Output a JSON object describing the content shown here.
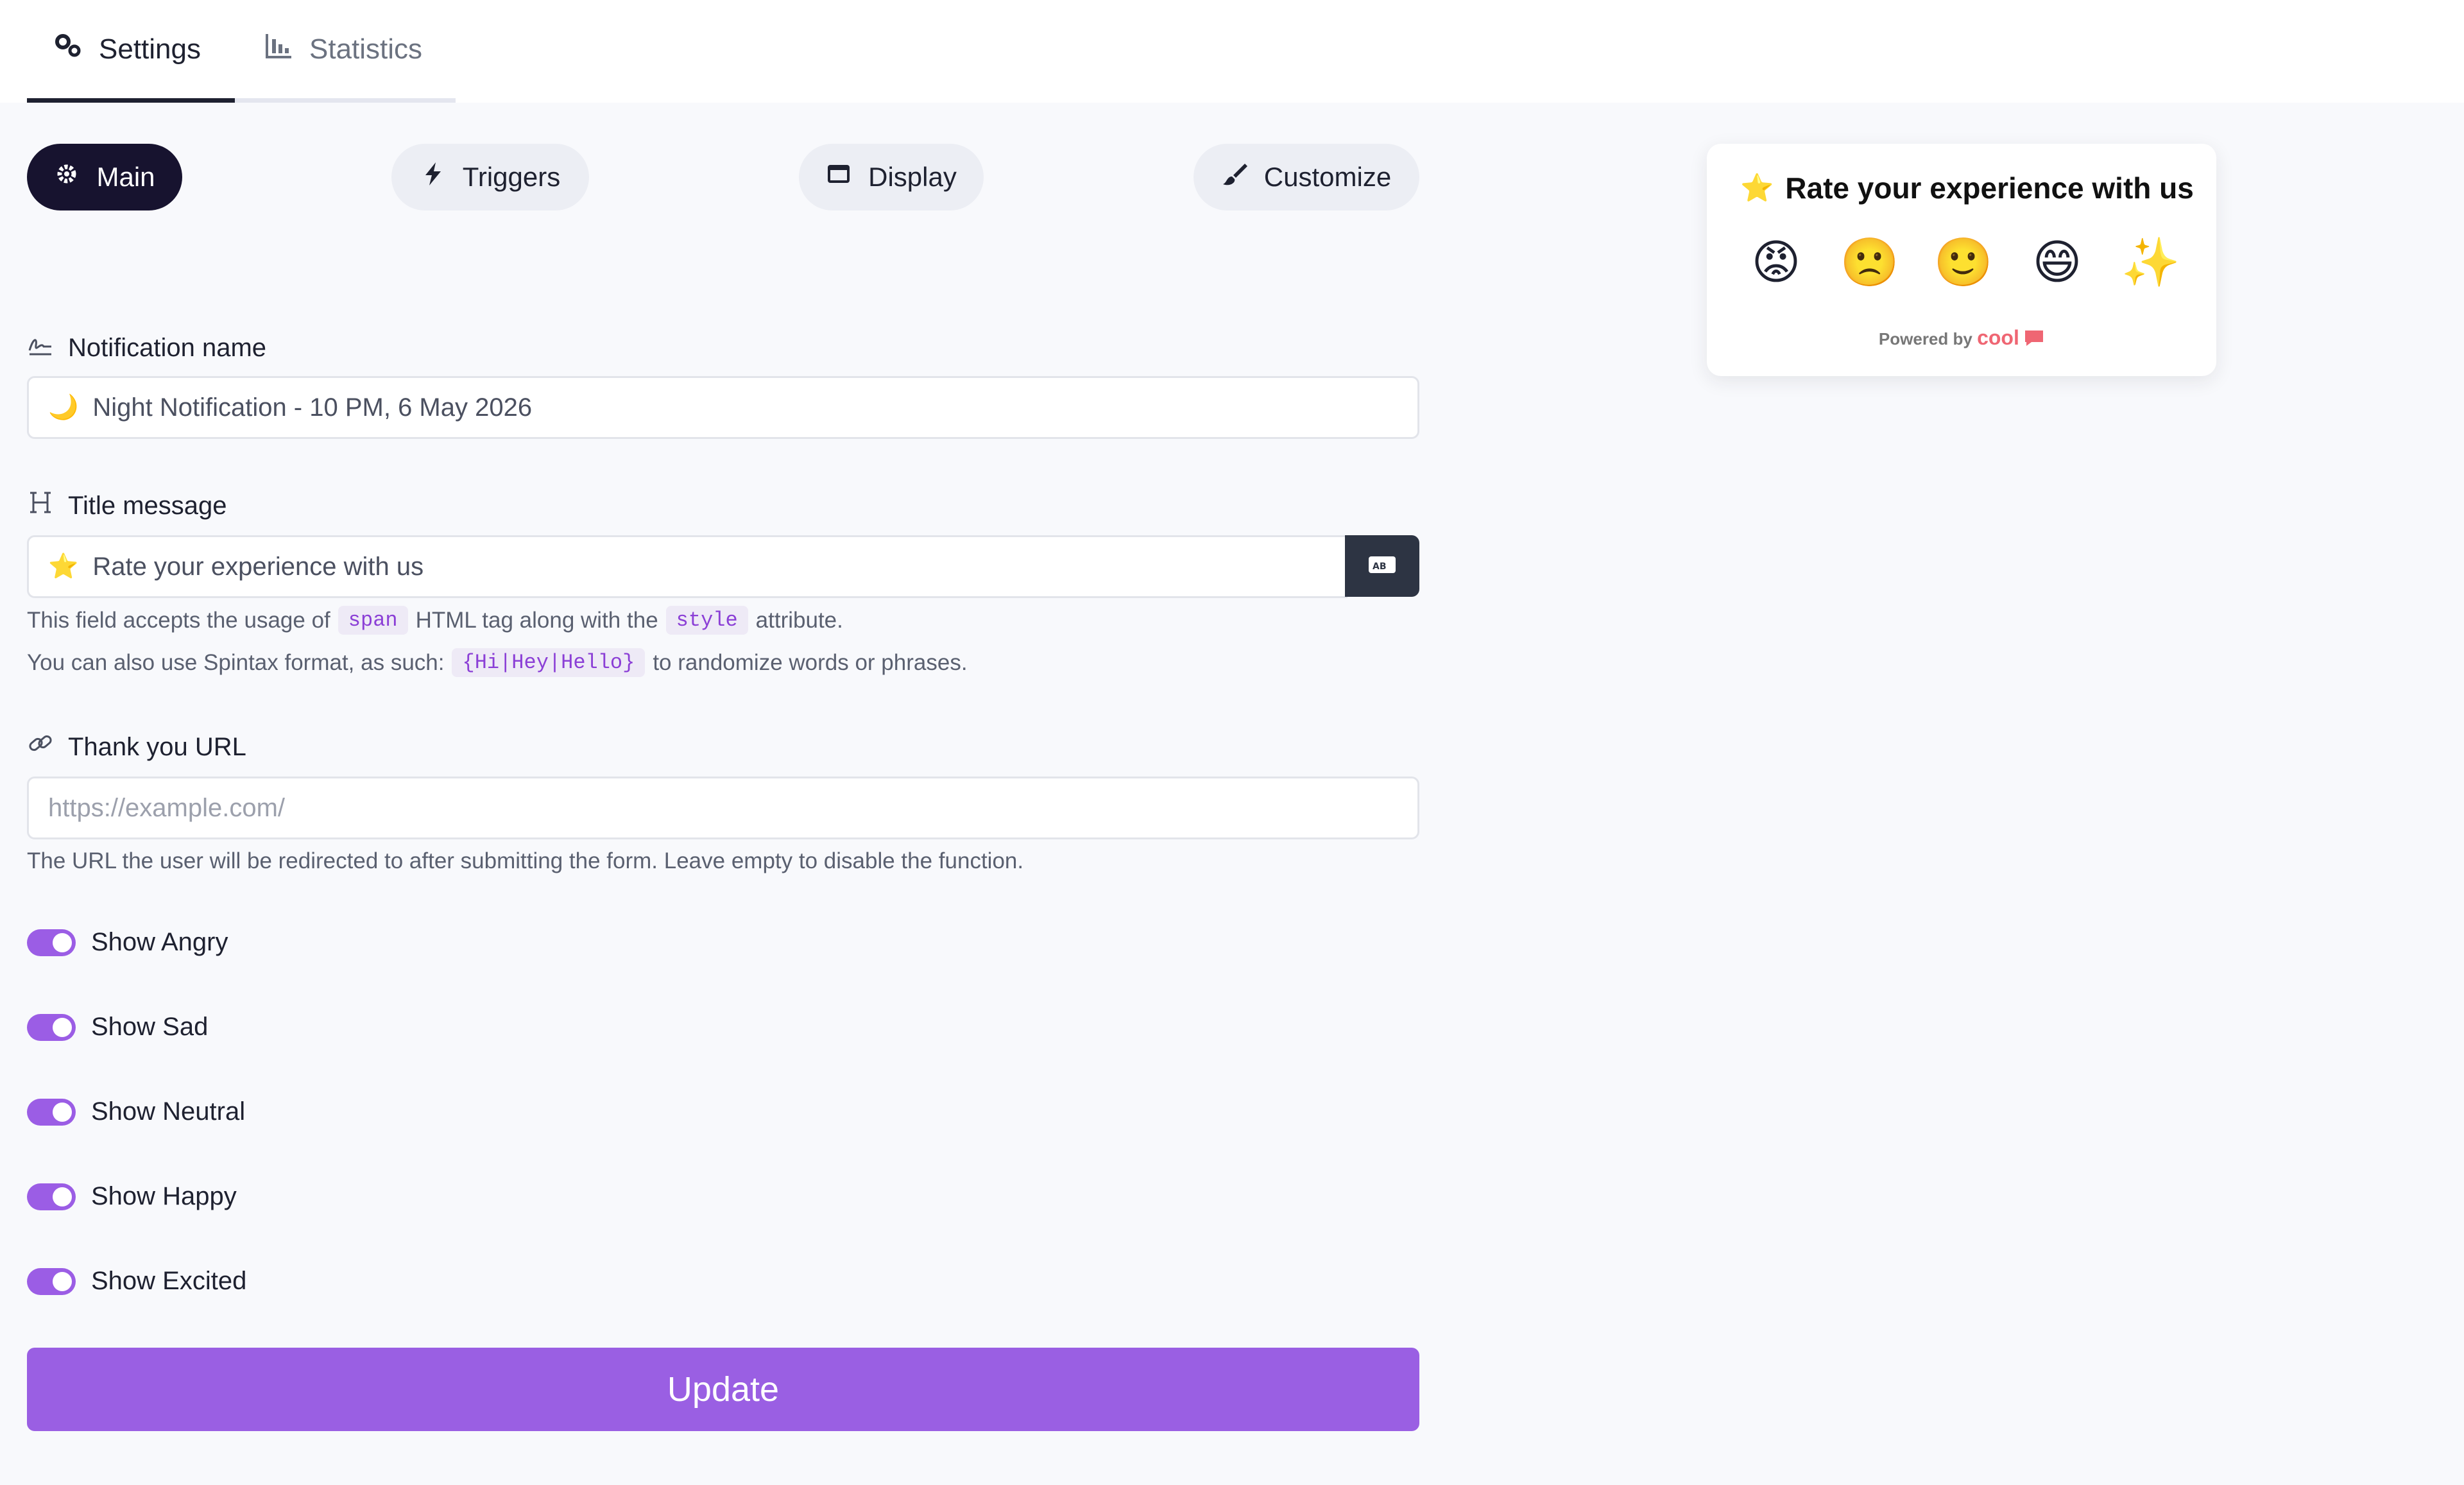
{
  "tabs": [
    {
      "label": "Settings",
      "icon": "gears-icon",
      "active": true
    },
    {
      "label": "Statistics",
      "icon": "bar-chart-icon",
      "active": false
    }
  ],
  "sections": [
    {
      "label": "Main",
      "icon": "gear-icon",
      "active": true
    },
    {
      "label": "Triggers",
      "icon": "bolt-icon",
      "active": false
    },
    {
      "label": "Display",
      "icon": "window-icon",
      "active": false
    },
    {
      "label": "Customize",
      "icon": "paintbrush-icon",
      "active": false
    }
  ],
  "form": {
    "notification_name": {
      "label": "Notification name",
      "icon": "signature-icon",
      "emoji": "🌙",
      "value": "Night Notification - 10 PM, 6 May 2026"
    },
    "title_message": {
      "label": "Title message",
      "icon": "heading-icon",
      "emoji": "⭐",
      "value": "Rate your experience with us",
      "help_1_pre": "This field accepts the usage of",
      "help_1_code1": "span",
      "help_1_mid": "HTML tag along with the",
      "help_1_code2": "style",
      "help_1_post": "attribute.",
      "help_2_pre": "You can also use Spintax format, as such:",
      "help_2_code": "{Hi|Hey|Hello}",
      "help_2_post": "to randomize words or phrases."
    },
    "thank_you_url": {
      "label": "Thank you URL",
      "icon": "link-icon",
      "value": "",
      "placeholder": "https://example.com/",
      "help": "The URL the user will be redirected to after submitting the form. Leave empty to disable the function."
    },
    "toggles": [
      {
        "label": "Show Angry",
        "on": true
      },
      {
        "label": "Show Sad",
        "on": true
      },
      {
        "label": "Show Neutral",
        "on": true
      },
      {
        "label": "Show Happy",
        "on": true
      },
      {
        "label": "Show Excited",
        "on": true
      }
    ],
    "submit_label": "Update"
  },
  "preview": {
    "star": "⭐",
    "title": "Rate your experience with us",
    "emojis": [
      "😡",
      "🙁",
      "🙂",
      "😄",
      "✨"
    ],
    "powered_by": "Powered by",
    "brand": "cool"
  },
  "colors": {
    "accent": "#9a5fe3",
    "dark": "#17132f",
    "input_button": "#2d3443",
    "brand": "#ef6673"
  }
}
